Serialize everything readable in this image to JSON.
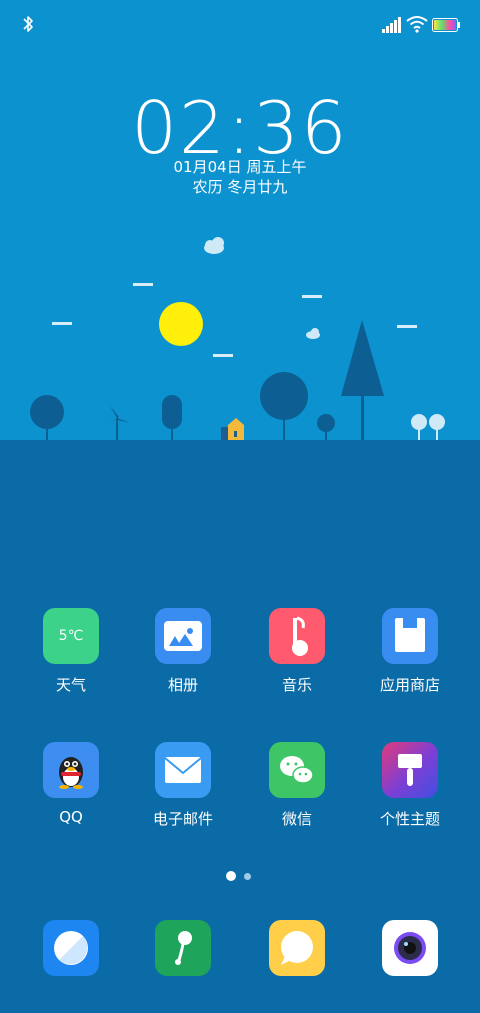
{
  "clock": {
    "time": "02:36"
  },
  "date": {
    "gregorian": "01月04日 周五上午",
    "lunar": "农历 冬月廿九"
  },
  "weather": {
    "temp": "5℃"
  },
  "apps": [
    {
      "label": "天气",
      "color": "#3CD28A"
    },
    {
      "label": "相册",
      "color": "#3A8DF0"
    },
    {
      "label": "音乐",
      "color": "#FF5A6E"
    },
    {
      "label": "应用商店",
      "color": "#3A8DF0"
    },
    {
      "label": "QQ",
      "color": "#3D8EF0"
    },
    {
      "label": "电子邮件",
      "color": "#3A9BF2"
    },
    {
      "label": "微信",
      "color": "#3DC566"
    },
    {
      "label": "个性主题",
      "color": "#7B3FD6"
    }
  ],
  "dock": [
    {
      "label": "browser-icon"
    },
    {
      "label": "phone-icon"
    },
    {
      "label": "messages-icon"
    },
    {
      "label": "camera-icon"
    }
  ],
  "pager": {
    "pages": 2,
    "current": 1
  }
}
